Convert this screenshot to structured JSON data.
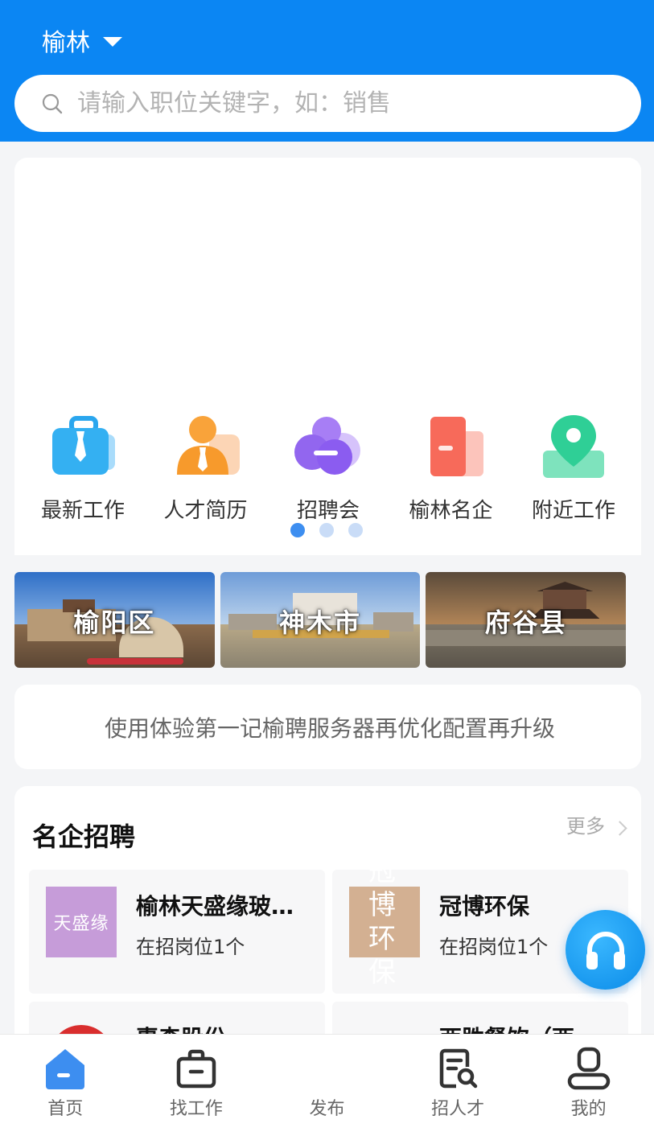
{
  "header": {
    "city": "榆林",
    "search_placeholder": "请输入职位关键字，如：销售"
  },
  "quick_links": [
    {
      "label": "最新工作",
      "icon": "briefcase-icon"
    },
    {
      "label": "人才简历",
      "icon": "person-icon"
    },
    {
      "label": "招聘会",
      "icon": "job-fair-icon"
    },
    {
      "label": "榆林名企",
      "icon": "company-card-icon"
    },
    {
      "label": "附近工作",
      "icon": "location-pin-icon"
    }
  ],
  "carousel": {
    "pages": 3,
    "active": 1
  },
  "districts": [
    {
      "name": "榆阳区"
    },
    {
      "name": "神木市"
    },
    {
      "name": "府谷县"
    }
  ],
  "notice": "使用体验第一记榆聘服务器再优化配置再升级",
  "companies_section": {
    "title": "名企招聘",
    "more": "更多",
    "items": [
      {
        "name": "榆林天盛缘玻璃制品有限公司",
        "jobs": "在招岗位1个",
        "logo_text": "天盛缘",
        "logo_color": "#c69cd9"
      },
      {
        "name": "冠博环保",
        "jobs": "在招岗位1个",
        "logo_text": "冠博环保",
        "logo_color": "#d3b092"
      },
      {
        "name": "惠森股份",
        "jobs": "",
        "logo_text": "",
        "logo_color": "#d92e2e"
      },
      {
        "name": "西胜餐饮（西安）",
        "jobs": "",
        "logo_text": "",
        "logo_color": "#d92e2e"
      }
    ]
  },
  "tabbar": [
    {
      "label": "首页",
      "icon": "home-icon",
      "active": true
    },
    {
      "label": "找工作",
      "icon": "briefcase-outline-icon"
    },
    {
      "label": "发布",
      "icon": "publish-icon"
    },
    {
      "label": "招人才",
      "icon": "search-resume-icon"
    },
    {
      "label": "我的",
      "icon": "profile-icon"
    }
  ],
  "colors": {
    "primary": "#0b86f3",
    "accent_dot": "#3d8ef0"
  }
}
